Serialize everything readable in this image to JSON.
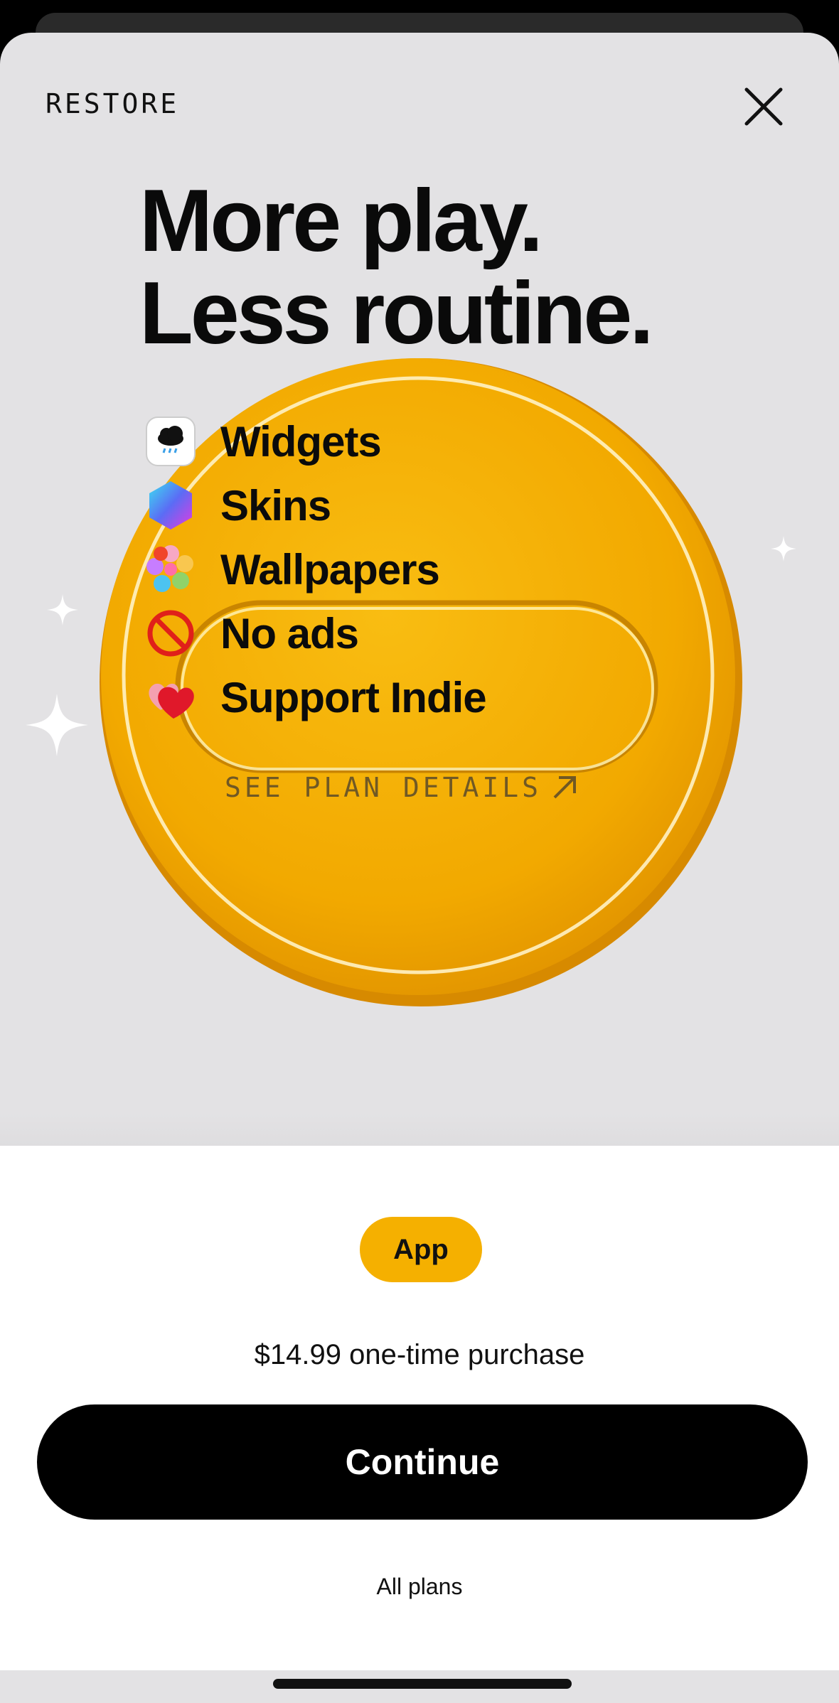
{
  "header": {
    "restore_label": "RESTORE",
    "close_icon": "close-icon"
  },
  "headline": {
    "line1": "More play.",
    "line2": "Less routine."
  },
  "features": [
    {
      "label": "Widgets",
      "icon": "weather-widget-icon"
    },
    {
      "label": "Skins",
      "icon": "hexagon-skins-icon"
    },
    {
      "label": "Wallpapers",
      "icon": "flower-wallpapers-icon"
    },
    {
      "label": "No ads",
      "icon": "prohibited-icon"
    },
    {
      "label": "Support Indie",
      "icon": "hearts-icon"
    }
  ],
  "plan_details": {
    "label": "SEE PLAN DETAILS",
    "icon": "arrow-up-right-icon"
  },
  "purchase": {
    "plan_badge": "App",
    "price_text": "$14.99 one-time purchase",
    "continue_label": "Continue",
    "all_plans_label": "All plans"
  },
  "colors": {
    "accent": "#f5b000",
    "sheet_background": "#e3e2e4",
    "button": "#000000"
  }
}
